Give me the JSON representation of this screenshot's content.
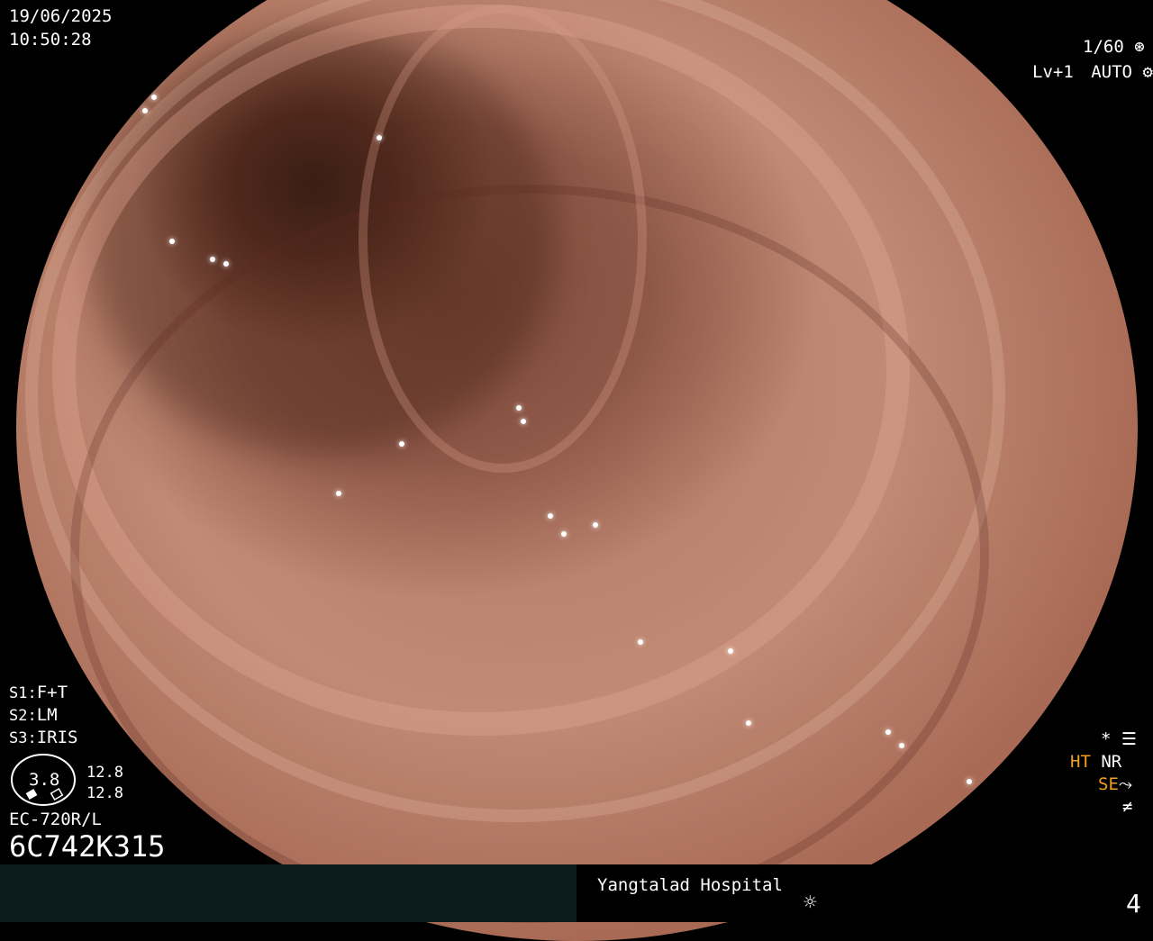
{
  "top_left": {
    "date": "19/06/2025",
    "time": "10:50:28"
  },
  "top_right": {
    "shutter": "1/60",
    "level": "Lv+1",
    "mode": "AUTO"
  },
  "left_panel": {
    "s1": "F+T",
    "s2": "LM",
    "s3": "IRIS",
    "s1_label": "S1:",
    "s2_label": "S2:",
    "s3_label": "S3:",
    "gauge_value": "3.8",
    "gauge_top": "12.8",
    "gauge_bottom": "12.8",
    "scope_model": "EC-720R/L",
    "serial": "6C742K315"
  },
  "right_panel": {
    "ht": "HT",
    "nr": "NR",
    "se": "SE",
    "star": "*"
  },
  "bottom": {
    "hospital": "Yangtalad Hospital",
    "page": "4"
  },
  "icons": [
    "aperture-icon",
    "gear-icon",
    "settings-menu-icon",
    "enhance-curve-icon",
    "not-equal-icon",
    "sun-icon"
  ],
  "colors": {
    "accent": "#f0a020",
    "bar": "#0c1c1c"
  }
}
